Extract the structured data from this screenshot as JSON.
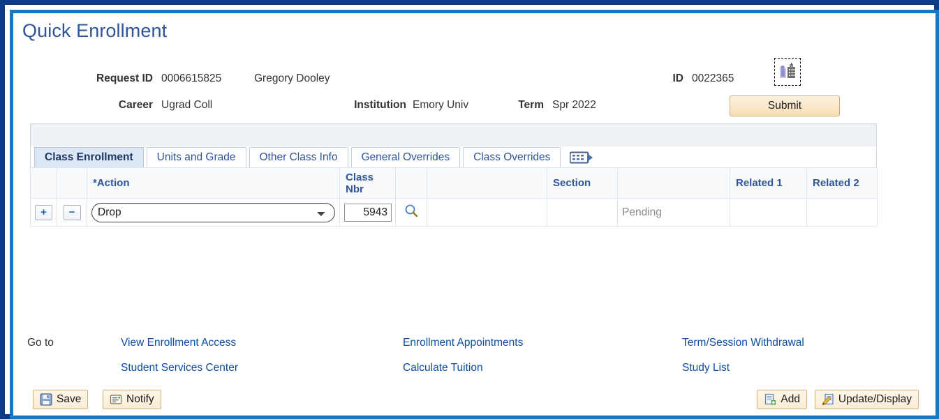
{
  "page": {
    "title": "Quick Enrollment"
  },
  "header": {
    "request_id_label": "Request ID",
    "request_id_value": "0006615825",
    "student_name": "Gregory Dooley",
    "career_label": "Career",
    "career_value": "Ugrad Coll",
    "institution_label": "Institution",
    "institution_value": "Emory Univ",
    "id_label": "ID",
    "id_value": "0022365",
    "term_label": "Term",
    "term_value": "Spr 2022",
    "campus_icon": "campus-building-icon",
    "submit_label": "Submit"
  },
  "tabs": [
    {
      "label": "Class Enrollment",
      "active": true
    },
    {
      "label": "Units and Grade",
      "active": false
    },
    {
      "label": "Other Class Info",
      "active": false
    },
    {
      "label": "General Overrides",
      "active": false
    },
    {
      "label": "Class Overrides",
      "active": false
    }
  ],
  "tab_icon": {
    "name": "show-all-columns-icon"
  },
  "grid": {
    "columns": [
      "",
      "",
      "*Action",
      "Class\nNbr",
      "",
      "",
      "Section",
      "",
      "Related 1",
      "Related 2"
    ],
    "column_labels": {
      "action": "*Action",
      "class_nbr_line1": "Class",
      "class_nbr_line2": "Nbr",
      "section": "Section",
      "related1": "Related 1",
      "related2": "Related 2"
    },
    "rows": [
      {
        "add_button": "+",
        "delete_button": "−",
        "action_value": "Drop",
        "action_options": [
          "Drop"
        ],
        "class_nbr": "5943",
        "lookup_icon": "magnifying-glass-icon",
        "blank_a": "",
        "section": "",
        "status": "Pending",
        "related1": "",
        "related2": ""
      }
    ]
  },
  "goto": {
    "label": "Go to",
    "links": [
      {
        "text": "View Enrollment Access",
        "col": 1,
        "row": 1
      },
      {
        "text": "Student Services Center",
        "col": 1,
        "row": 2
      },
      {
        "text": "Enrollment Appointments",
        "col": 2,
        "row": 1
      },
      {
        "text": "Calculate Tuition",
        "col": 2,
        "row": 2
      },
      {
        "text": "Term/Session Withdrawal",
        "col": 3,
        "row": 1
      },
      {
        "text": "Study List",
        "col": 3,
        "row": 2
      }
    ]
  },
  "toolbar": {
    "save_label": "Save",
    "save_icon": "floppy-disk-icon",
    "notify_label": "Notify",
    "notify_icon": "notify-envelope-icon",
    "add_label": "Add",
    "add_icon": "page-add-icon",
    "update_display_label": "Update/Display",
    "update_display_icon": "pencil-page-icon"
  },
  "colors": {
    "outer_frame": "#0d3b87",
    "inner_frame": "#1878c4",
    "title_text": "#2f5597",
    "link_blue": "#0b4da2",
    "tab_active_bg": "#dce6f4",
    "button_cream": "#fbedd6",
    "status_grey": "#8a8a8a"
  }
}
